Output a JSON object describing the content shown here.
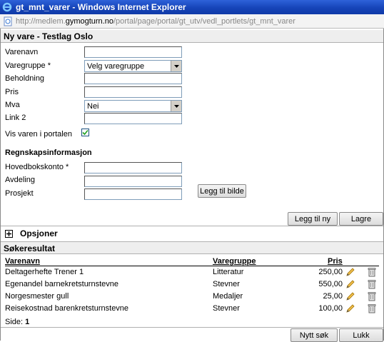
{
  "window": {
    "title": "gt_mnt_varer - Windows Internet Explorer"
  },
  "address": {
    "prefix": "http://medlem.",
    "host": "gymogturn.no",
    "path": "/portal/page/portal/gt_utv/vedl_portlets/gt_mnt_varer"
  },
  "form": {
    "header": "Ny vare - Testlag Oslo",
    "varenavn_label": "Varenavn",
    "varegruppe_label": "Varegruppe *",
    "varegruppe_value": "Velg varegruppe",
    "beholdning_label": "Beholdning",
    "pris_label": "Pris",
    "mva_label": "Mva",
    "mva_value": "Nei",
    "link2_label": "Link 2",
    "vis_label": "Vis varen i portalen",
    "vis_checked": true,
    "regnskap_heading": "Regnskapsinformasjon",
    "hovedbok_label": "Hovedbokskonto *",
    "avdeling_label": "Avdeling",
    "prosjekt_label": "Prosjekt",
    "legg_til_bilde": "Legg til bilde",
    "legg_til_ny": "Legg til ny",
    "lagre": "Lagre"
  },
  "options": {
    "expand_icon": "plus-box-icon",
    "label": "Opsjoner"
  },
  "results": {
    "header": "Søkeresultat",
    "columns": {
      "varenavn": "Varenavn",
      "varegruppe": "Varegruppe",
      "pris": "Pris"
    },
    "rows": [
      {
        "varenavn": "Deltagerhefte Trener 1",
        "varegruppe": "Litteratur",
        "pris": "250,00"
      },
      {
        "varenavn": "Egenandel barnekretsturnstevne",
        "varegruppe": "Stevner",
        "pris": "550,00"
      },
      {
        "varenavn": "Norgesmester gull",
        "varegruppe": "Medaljer",
        "pris": "25,00"
      },
      {
        "varenavn": "Reisekostnad barenkretsturnstevne",
        "varegruppe": "Stevner",
        "pris": "100,00"
      }
    ],
    "side_label": "Side:",
    "side_value": "1",
    "nytt_sok": "Nytt søk",
    "lukk": "Lukk"
  }
}
